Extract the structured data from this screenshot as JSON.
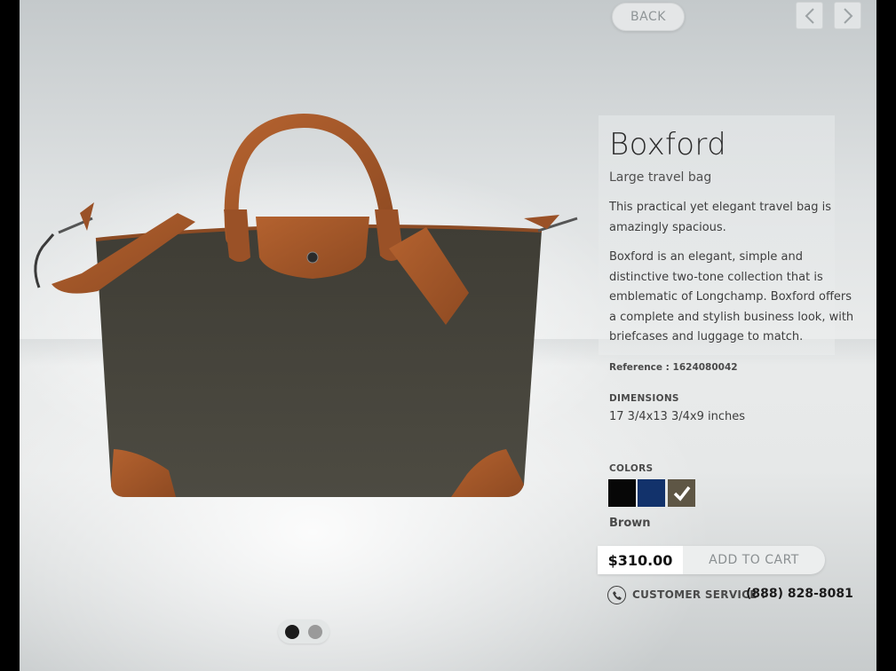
{
  "nav": {
    "back_label": "BACK",
    "prev_icon": "chevron-left-icon",
    "next_icon": "chevron-right-icon"
  },
  "product": {
    "name": "Boxford",
    "subtitle": "Large travel bag",
    "description_1": "This practical yet elegant travel bag is amazingly spacious.",
    "description_2": "Boxford is an elegant, simple and distinctive two-tone collection that is emblematic of Longchamp. Boxford offers a complete and stylish business look, with briefcases and luggage to match.",
    "reference": "Reference : 1624080042",
    "dimensions_label": "DIMENSIONS",
    "dimensions_value": "17 3/4x13 3/4x9 inches",
    "colors_label": "COLORS",
    "colors": [
      {
        "name": "Black",
        "hex": "#070707"
      },
      {
        "name": "Navy",
        "hex": "#12326b"
      },
      {
        "name": "Brown",
        "hex": "#5e5645",
        "selected": true
      }
    ],
    "selected_color": "Brown",
    "price": "$310.00",
    "add_to_cart": "ADD TO CART"
  },
  "support": {
    "label": "CUSTOMER SERVICE :",
    "phone": "(888) 828-8081",
    "icon": "phone-icon"
  },
  "gallery": {
    "pages": 2,
    "current": 1
  },
  "theme": {
    "bag_body": "#4b4941",
    "leather": "#a0522d"
  }
}
